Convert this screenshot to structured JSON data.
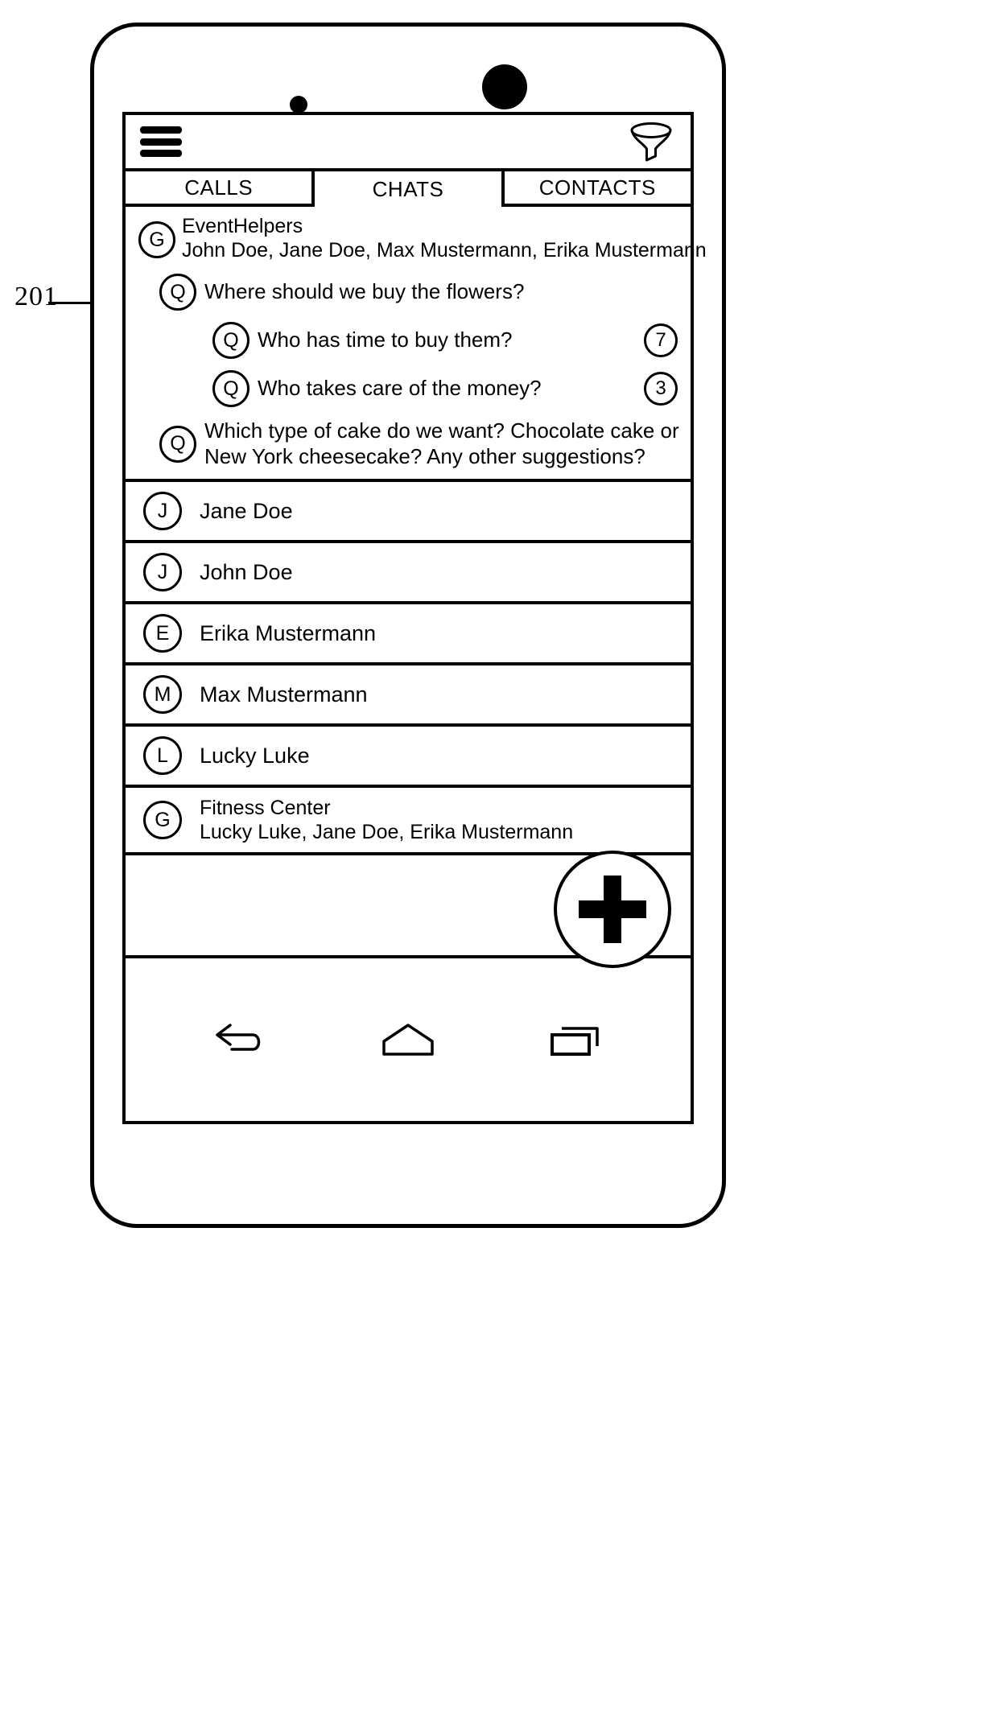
{
  "figure": {
    "reference_numeral": "201"
  },
  "device": {
    "sensor_icon": "proximity-sensor-dot",
    "camera_icon": "front-camera-dot"
  },
  "appbar": {
    "menu_icon": "hamburger-menu-icon",
    "filter_icon": "funnel-filter-icon"
  },
  "tabs": [
    {
      "label": "CALLS",
      "active": false
    },
    {
      "label": "CHATS",
      "active": true
    },
    {
      "label": "CONTACTS",
      "active": false
    }
  ],
  "thread": {
    "avatar": "G",
    "title": "EventHelpers",
    "participants": "John Doe, Jane Doe, Max Mustermann, Erika Mustermann",
    "questions": [
      {
        "marker": "Q",
        "text": "Where should we buy the flowers?",
        "badge": "",
        "level": 0
      },
      {
        "marker": "Q",
        "text": "Who has time to buy them?",
        "badge": "7",
        "level": 1
      },
      {
        "marker": "Q",
        "text": "Who takes care of the money?",
        "badge": "3",
        "level": 1
      },
      {
        "marker": "Q",
        "text": "Which type of cake do we want? Chocolate cake or New York cheesecake? Any other suggestions?",
        "badge": "",
        "level": 0
      }
    ]
  },
  "contacts": [
    {
      "avatar": "J",
      "name": "Jane Doe",
      "sub": "",
      "group": false
    },
    {
      "avatar": "J",
      "name": "John Doe",
      "sub": "",
      "group": false
    },
    {
      "avatar": "E",
      "name": "Erika Mustermann",
      "sub": "",
      "group": false
    },
    {
      "avatar": "M",
      "name": "Max Mustermann",
      "sub": "",
      "group": false
    },
    {
      "avatar": "L",
      "name": "Lucky Luke",
      "sub": "",
      "group": false
    },
    {
      "avatar": "G",
      "name": "Fitness Center",
      "sub": "Lucky Luke, Jane Doe, Erika Mustermann",
      "group": true
    }
  ],
  "fab": {
    "icon": "plus-icon",
    "label": "+"
  },
  "navbar": {
    "back_icon": "back-arrow-icon",
    "home_icon": "home-pentagon-icon",
    "recents_icon": "recent-apps-icon"
  },
  "colors": {
    "stroke": "#000000",
    "background": "#ffffff"
  }
}
